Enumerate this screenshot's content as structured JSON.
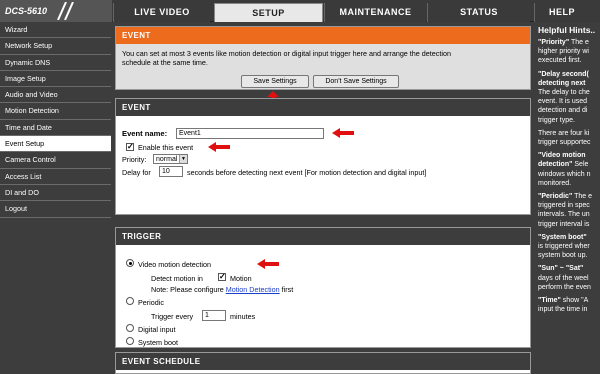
{
  "header": {
    "logo": "DCS-5610",
    "tabs": [
      {
        "label": "LIVE VIDEO"
      },
      {
        "label": "SETUP"
      },
      {
        "label": "MAINTENANCE"
      },
      {
        "label": "STATUS"
      },
      {
        "label": "HELP"
      }
    ]
  },
  "sidebar": {
    "items": [
      {
        "label": "Wizard"
      },
      {
        "label": "Network Setup"
      },
      {
        "label": "Dynamic DNS"
      },
      {
        "label": "Image Setup"
      },
      {
        "label": "Audio and Video"
      },
      {
        "label": "Motion Detection"
      },
      {
        "label": "Time and Date"
      },
      {
        "label": "Event Setup"
      },
      {
        "label": "Camera Control"
      },
      {
        "label": "Access List"
      },
      {
        "label": "DI and DO"
      },
      {
        "label": "Logout"
      }
    ]
  },
  "event_notice": {
    "title": "EVENT",
    "text_line1": "You can set at most 3 events like motion detection or digital input trigger here and arrange the detection",
    "text_line2": "schedule at the same time.",
    "save_label": "Save Settings",
    "dont_save_label": "Don't Save Settings"
  },
  "event": {
    "title": "EVENT",
    "name_label": "Event name:",
    "name_value": "Event1",
    "enable_label": "Enable this event",
    "priority_label": "Priority:",
    "priority_value": "normal",
    "delay_prefix": "Delay for",
    "delay_value": "10",
    "delay_suffix": "seconds before detecting next event [For motion detection and digital input]"
  },
  "trigger": {
    "title": "TRIGGER",
    "vmd_label": "Video motion detection",
    "detect_in_label": "Detect motion in",
    "motion_label": "Motion",
    "note_prefix": "Note: Please configure",
    "note_link": "Motion Detection",
    "note_suffix": "first",
    "periodic_label": "Periodic",
    "trigger_every_label": "Trigger every",
    "trigger_every_value": "1",
    "minutes_label": "minutes",
    "digital_input_label": "Digital input",
    "system_boot_label": "System boot"
  },
  "schedule": {
    "title": "EVENT SCHEDULE"
  },
  "hints": {
    "title": "Helpful Hints..",
    "h1_title": "\"Priority\"",
    "h1_body": " The e\nhigher priority wi\nexecuted first.",
    "h2_title": "\"Delay second(\ndetecting next",
    "h2_body": "The delay to che\nevent. It is used\ndetection and di\ntrigger type.",
    "h3_body": "There are four ki\ntrigger supportec",
    "h4_title": "\"Video motion\ndetection\"",
    "h4_body": " Sele\nwindows which n\nmonitored.",
    "h5_title": "\"Periodic\"",
    "h5_body": " The e\ntriggered in spec\nintervals. The un\ntrigger interval is",
    "h6_title": "\"System boot\"",
    "h6_body": "\nis triggered wher\nsystem boot up.",
    "h7_title": "\"Sun\" ~ \"Sat\"",
    "h7_body": "\ndays of the weel\nperform the even",
    "h8_title": "\"Time\"",
    "h8_body": " show \"A\ninput the time in"
  },
  "colors": {
    "accent_orange": "#ec6b1d",
    "annotation_red": "#e01010",
    "panel_dark": "#3d3d3d"
  }
}
